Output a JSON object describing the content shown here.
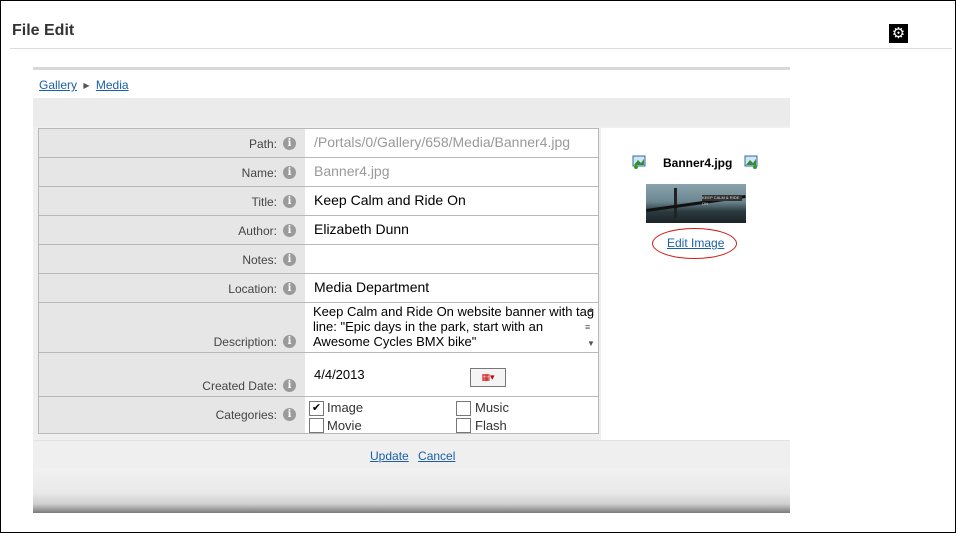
{
  "page": {
    "title": "File Edit",
    "settings_icon": "gear-icon"
  },
  "breadcrumb": {
    "items": [
      "Gallery",
      "Media"
    ]
  },
  "form": {
    "path": {
      "label": "Path:",
      "value": "/Portals/0/Gallery/658/Media/Banner4.jpg"
    },
    "name": {
      "label": "Name:",
      "value": "Banner4.jpg"
    },
    "title": {
      "label": "Title:",
      "value": "Keep Calm and Ride On"
    },
    "author": {
      "label": "Author:",
      "value": "Elizabeth Dunn"
    },
    "notes": {
      "label": "Notes:",
      "value": ""
    },
    "location": {
      "label": "Location:",
      "value": "Media Department"
    },
    "description": {
      "label": "Description:",
      "value": "Keep Calm and Ride On website banner with tag line: \"Epic days in the park, start with an Awesome Cycles BMX bike\""
    },
    "created_date": {
      "label": "Created Date:",
      "value": "4/4/2013"
    },
    "categories": {
      "label": "Categories:",
      "options": [
        {
          "label": "Image",
          "checked": true
        },
        {
          "label": "Music",
          "checked": false
        },
        {
          "label": "Movie",
          "checked": false
        },
        {
          "label": "Flash",
          "checked": false
        }
      ]
    }
  },
  "preview": {
    "filename": "Banner4.jpg",
    "edit_label": "Edit Image",
    "thumb_text": "KEEP CALM & RIDE ON"
  },
  "actions": {
    "update": "Update",
    "cancel": "Cancel"
  }
}
